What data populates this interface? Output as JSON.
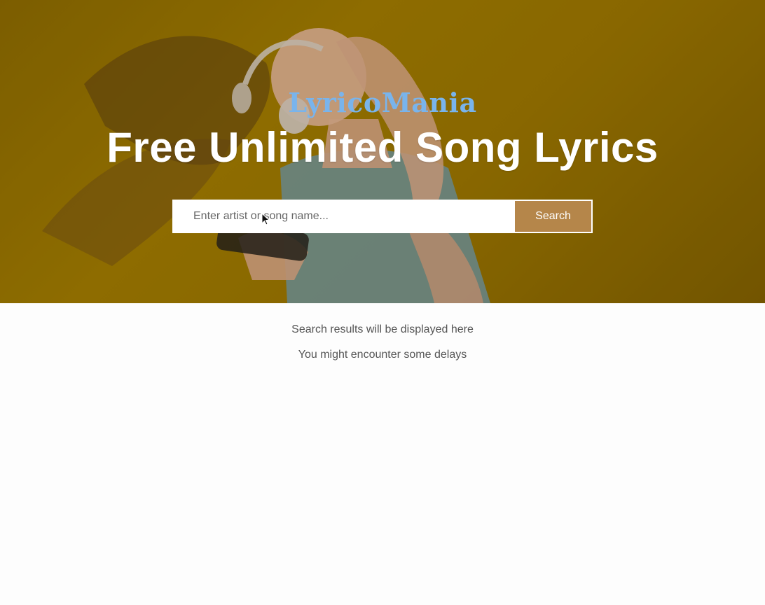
{
  "hero": {
    "brand": "LyricoMania",
    "headline": "Free Unlimited Song Lyrics"
  },
  "search": {
    "placeholder": "Enter artist or song name...",
    "value": "",
    "button_label": "Search"
  },
  "results": {
    "line1": "Search results will be displayed here",
    "line2": "You might encounter some delays"
  },
  "colors": {
    "brand": "#79b4ec",
    "button": "#b5864a",
    "hero_background": "#9a7600"
  }
}
